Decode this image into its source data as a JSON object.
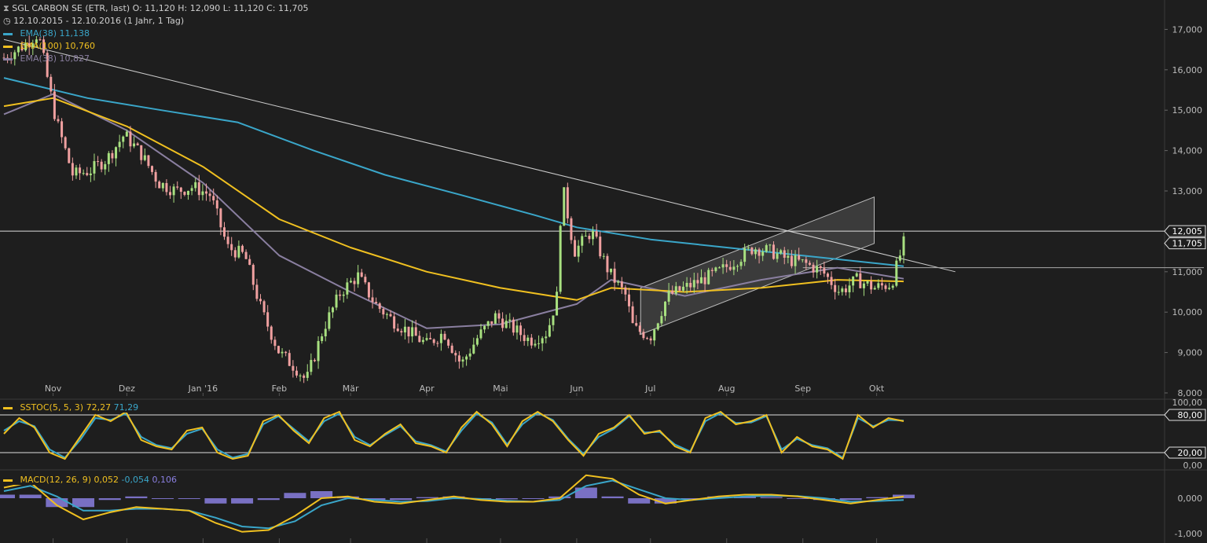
{
  "header": {
    "title": "SGL CARBON SE (ETR, last)",
    "o_label": "O:",
    "o": "11,120",
    "h_label": "H:",
    "h": "12,090",
    "l_label": "L:",
    "l": "11,120",
    "c_label": "C:",
    "c": "11,705",
    "period": "12.10.2015 - 12.10.2016 (1 Jahr, 1 Tag)"
  },
  "legend": {
    "ema1_label": "EMA(38)",
    "ema1_value": "11,138",
    "ema1_color": "#3aa6c9",
    "ema2_label": "EMA(100)",
    "ema2_value": "10,760",
    "ema2_color": "#f0c020",
    "ema3_label": "EMA(38)",
    "ema3_value": "10,827",
    "ema3_color": "#8a7fa0"
  },
  "stoch": {
    "label": "SSTOC(5, 5, 3)",
    "k": "72,27",
    "d": "71,29"
  },
  "macd": {
    "label": "MACD(12, 26, 9)",
    "macd": "0,052",
    "signal": "-0,054",
    "hist": "0,106"
  },
  "colors": {
    "up": "#a8e080",
    "down": "#f0a0a0",
    "background": "#1e1e1e",
    "ema_blue": "#3aa6c9",
    "ema_yellow": "#f0c020",
    "ema_purple": "#8a7fa0",
    "macd_hist": "#8a7fe0",
    "grid": "#2a2a2a"
  },
  "chart_data": {
    "type": "candlestick",
    "price_axis": [
      "17,000",
      "16,000",
      "15,000",
      "14,000",
      "13,000",
      "12,000",
      "11,000",
      "10,000",
      "9,000",
      "8,000"
    ],
    "ylim": [
      8.0,
      17.3
    ],
    "months": [
      "Nov",
      "Dez",
      "Jan '16",
      "Feb",
      "Mär",
      "Apr",
      "Mai",
      "Jun",
      "Jul",
      "Aug",
      "Sep",
      "Okt"
    ],
    "price_tags": [
      {
        "value": 12.005,
        "label": "12,005",
        "style": "outline"
      },
      {
        "value": 11.705,
        "label": "11,705",
        "style": "outline"
      }
    ],
    "horizontal_lines": [
      12.005,
      11.1
    ],
    "trendline": {
      "from": [
        "2015-10-12",
        16.75
      ],
      "to": [
        "2016-11-02",
        11.0
      ]
    },
    "channel": {
      "lower_start": [
        "2016-06-27",
        9.45
      ],
      "lower_end": [
        "2016-09-30",
        11.7
      ],
      "upper_start": [
        "2016-06-27",
        10.6
      ],
      "upper_end": [
        "2016-09-30",
        12.85
      ]
    },
    "close_path": [
      [
        "2015-10-12",
        16.3
      ],
      [
        "2015-10-20",
        16.6
      ],
      [
        "2015-10-26",
        16.9
      ],
      [
        "2015-11-02",
        14.8
      ],
      [
        "2015-11-09",
        13.4
      ],
      [
        "2015-11-16",
        13.5
      ],
      [
        "2015-11-23",
        13.8
      ],
      [
        "2015-11-30",
        14.4
      ],
      [
        "2015-12-07",
        13.9
      ],
      [
        "2015-12-14",
        13.2
      ],
      [
        "2015-12-21",
        13.0
      ],
      [
        "2015-12-28",
        13.1
      ],
      [
        "2016-01-04",
        12.9
      ],
      [
        "2016-01-11",
        11.6
      ],
      [
        "2016-01-18",
        11.4
      ],
      [
        "2016-01-25",
        10.0
      ],
      [
        "2016-02-01",
        9.0
      ],
      [
        "2016-02-08",
        8.6
      ],
      [
        "2016-02-12",
        8.3
      ],
      [
        "2016-02-19",
        9.6
      ],
      [
        "2016-02-26",
        10.5
      ],
      [
        "2016-03-04",
        10.9
      ],
      [
        "2016-03-11",
        10.2
      ],
      [
        "2016-03-18",
        9.8
      ],
      [
        "2016-03-25",
        9.5
      ],
      [
        "2016-04-01",
        9.2
      ],
      [
        "2016-04-08",
        9.5
      ],
      [
        "2016-04-15",
        8.7
      ],
      [
        "2016-04-22",
        9.4
      ],
      [
        "2016-04-29",
        9.9
      ],
      [
        "2016-05-06",
        9.6
      ],
      [
        "2016-05-13",
        9.3
      ],
      [
        "2016-05-20",
        9.5
      ],
      [
        "2016-05-24",
        10.4
      ],
      [
        "2016-05-26",
        13.2
      ],
      [
        "2016-05-31",
        11.5
      ],
      [
        "2016-06-07",
        12.0
      ],
      [
        "2016-06-14",
        11.0
      ],
      [
        "2016-06-21",
        10.4
      ],
      [
        "2016-06-24",
        9.6
      ],
      [
        "2016-07-01",
        9.4
      ],
      [
        "2016-07-08",
        10.4
      ],
      [
        "2016-07-15",
        10.6
      ],
      [
        "2016-07-22",
        10.8
      ],
      [
        "2016-07-29",
        11.0
      ],
      [
        "2016-08-05",
        11.3
      ],
      [
        "2016-08-12",
        11.6
      ],
      [
        "2016-08-19",
        11.5
      ],
      [
        "2016-08-26",
        11.3
      ],
      [
        "2016-09-02",
        11.2
      ],
      [
        "2016-09-09",
        11.0
      ],
      [
        "2016-09-16",
        10.5
      ],
      [
        "2016-09-23",
        10.8
      ],
      [
        "2016-09-30",
        10.6
      ],
      [
        "2016-10-07",
        10.7
      ],
      [
        "2016-10-12",
        11.705
      ]
    ],
    "ema_38_blue": [
      [
        "2015-10-12",
        15.8
      ],
      [
        "2015-11-15",
        15.3
      ],
      [
        "2015-12-15",
        15.0
      ],
      [
        "2016-01-15",
        14.7
      ],
      [
        "2016-02-15",
        14.0
      ],
      [
        "2016-03-15",
        13.4
      ],
      [
        "2016-04-15",
        12.9
      ],
      [
        "2016-05-15",
        12.4
      ],
      [
        "2016-06-01",
        12.1
      ],
      [
        "2016-07-01",
        11.8
      ],
      [
        "2016-08-01",
        11.6
      ],
      [
        "2016-09-01",
        11.4
      ],
      [
        "2016-10-12",
        11.138
      ]
    ],
    "ema_100_yellow": [
      [
        "2015-10-12",
        15.1
      ],
      [
        "2015-11-01",
        15.3
      ],
      [
        "2015-12-01",
        14.6
      ],
      [
        "2016-01-01",
        13.6
      ],
      [
        "2016-02-01",
        12.3
      ],
      [
        "2016-03-01",
        11.6
      ],
      [
        "2016-04-01",
        11.0
      ],
      [
        "2016-05-01",
        10.6
      ],
      [
        "2016-06-01",
        10.3
      ],
      [
        "2016-06-15",
        10.6
      ],
      [
        "2016-07-15",
        10.5
      ],
      [
        "2016-08-15",
        10.6
      ],
      [
        "2016-09-15",
        10.8
      ],
      [
        "2016-10-12",
        10.76
      ]
    ],
    "ema_38_purple": [
      [
        "2015-10-12",
        14.9
      ],
      [
        "2015-11-01",
        15.4
      ],
      [
        "2015-12-01",
        14.5
      ],
      [
        "2016-01-01",
        13.2
      ],
      [
        "2016-02-01",
        11.4
      ],
      [
        "2016-03-01",
        10.5
      ],
      [
        "2016-04-01",
        9.6
      ],
      [
        "2016-05-01",
        9.7
      ],
      [
        "2016-06-01",
        10.2
      ],
      [
        "2016-06-15",
        10.8
      ],
      [
        "2016-07-15",
        10.4
      ],
      [
        "2016-08-15",
        10.8
      ],
      [
        "2016-09-15",
        11.1
      ],
      [
        "2016-10-12",
        10.827
      ]
    ],
    "stoch_axis": [
      "100,00",
      "80,00",
      "20,00",
      "0,00"
    ],
    "stoch_k": [
      50,
      75,
      60,
      20,
      10,
      45,
      80,
      70,
      85,
      40,
      30,
      25,
      55,
      60,
      20,
      10,
      15,
      70,
      80,
      55,
      35,
      75,
      85,
      40,
      30,
      50,
      65,
      35,
      30,
      20,
      60,
      85,
      65,
      30,
      70,
      85,
      70,
      40,
      15,
      50,
      60,
      80,
      50,
      55,
      30,
      20,
      75,
      85,
      65,
      70,
      80,
      20,
      45,
      30,
      25,
      10,
      80,
      60,
      75,
      70
    ],
    "stoch_d": [
      55,
      70,
      62,
      25,
      12,
      40,
      75,
      72,
      82,
      45,
      32,
      27,
      50,
      58,
      25,
      12,
      18,
      65,
      78,
      58,
      38,
      70,
      82,
      45,
      32,
      48,
      62,
      38,
      32,
      22,
      55,
      82,
      68,
      33,
      65,
      83,
      72,
      42,
      18,
      45,
      58,
      78,
      52,
      53,
      33,
      22,
      70,
      83,
      67,
      68,
      78,
      25,
      42,
      32,
      27,
      12,
      75,
      62,
      72,
      71
    ],
    "macd_axis": [
      "0,000",
      "-1,000"
    ],
    "macd_line": [
      0.3,
      0.45,
      -0.2,
      -0.6,
      -0.4,
      -0.25,
      -0.3,
      -0.35,
      -0.7,
      -0.95,
      -0.9,
      -0.5,
      0.0,
      0.05,
      -0.1,
      -0.15,
      -0.05,
      0.05,
      -0.05,
      -0.1,
      -0.1,
      0.0,
      0.65,
      0.55,
      0.1,
      -0.15,
      -0.05,
      0.05,
      0.1,
      0.1,
      0.05,
      -0.05,
      -0.15,
      -0.05,
      0.05
    ],
    "macd_signal": [
      0.2,
      0.35,
      0.05,
      -0.35,
      -0.35,
      -0.3,
      -0.3,
      -0.35,
      -0.55,
      -0.8,
      -0.85,
      -0.65,
      -0.2,
      0.0,
      -0.05,
      -0.1,
      -0.08,
      0.0,
      -0.02,
      -0.07,
      -0.1,
      -0.05,
      0.35,
      0.5,
      0.25,
      0.0,
      -0.05,
      0.0,
      0.05,
      0.07,
      0.06,
      0.0,
      -0.1,
      -0.08,
      -0.05
    ],
    "macd_hist": [
      0.1,
      0.1,
      -0.25,
      -0.25,
      -0.05,
      0.05,
      0.0,
      0.0,
      -0.15,
      -0.15,
      -0.05,
      0.15,
      0.2,
      0.05,
      -0.05,
      -0.05,
      0.03,
      0.05,
      -0.03,
      -0.03,
      0.0,
      0.05,
      0.3,
      0.05,
      -0.15,
      -0.15,
      0.0,
      0.05,
      0.05,
      0.03,
      -0.01,
      -0.05,
      -0.05,
      0.03,
      0.1
    ]
  }
}
